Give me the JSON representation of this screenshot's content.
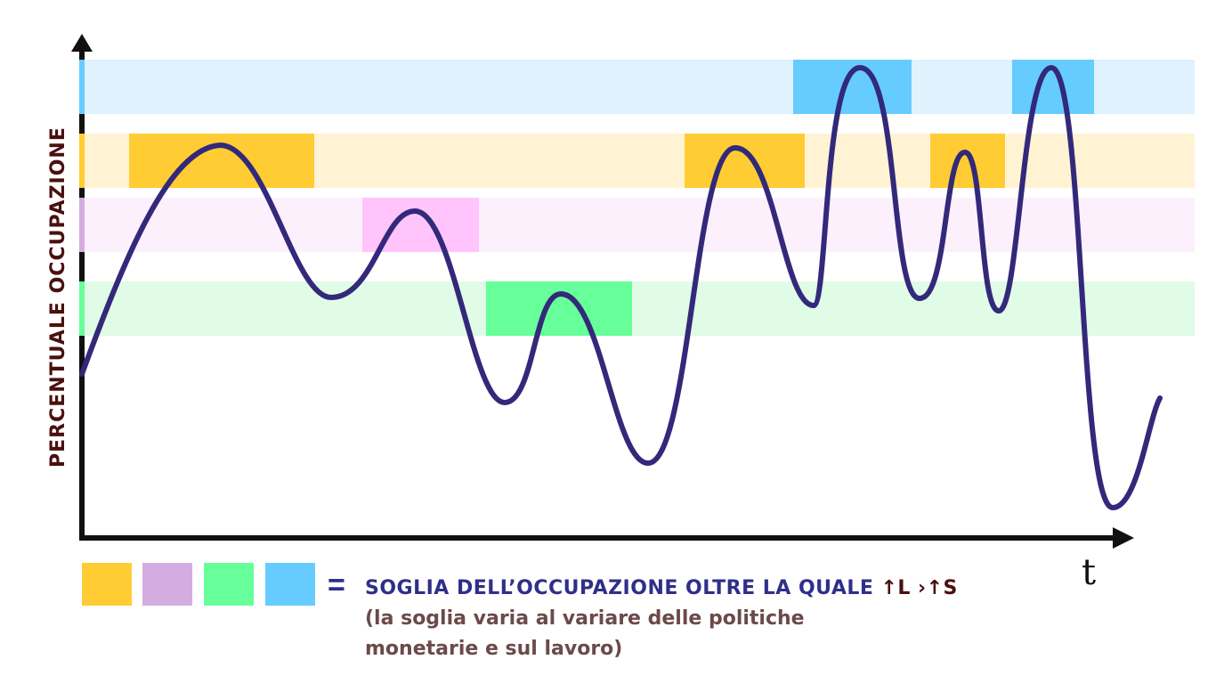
{
  "axes": {
    "y_label": "PERCENTUALE OCCUPAZIONE",
    "x_label": "t"
  },
  "bands": [
    {
      "name": "blue-band",
      "color": "#dff2fd"
    },
    {
      "name": "yellow-band",
      "color": "#fff3d4"
    },
    {
      "name": "purple-band",
      "color": "#fdf0fd"
    },
    {
      "name": "green-band",
      "color": "#e0fbe6"
    }
  ],
  "threshold_colors": {
    "yellow": "#ffcc33",
    "purple": "#d4acdf",
    "green": "#66ff99",
    "blue": "#66ccff"
  },
  "curve_color": "#33297a",
  "legend": {
    "equals": "=",
    "definition": "SOGLIA DELL’OCCUPAZIONE OLTRE LA QUALE",
    "arrows": "↑L ›↑S",
    "note_line1": "(la soglia varia al variare delle politiche",
    "note_line2": "monetarie e sul lavoro)"
  }
}
